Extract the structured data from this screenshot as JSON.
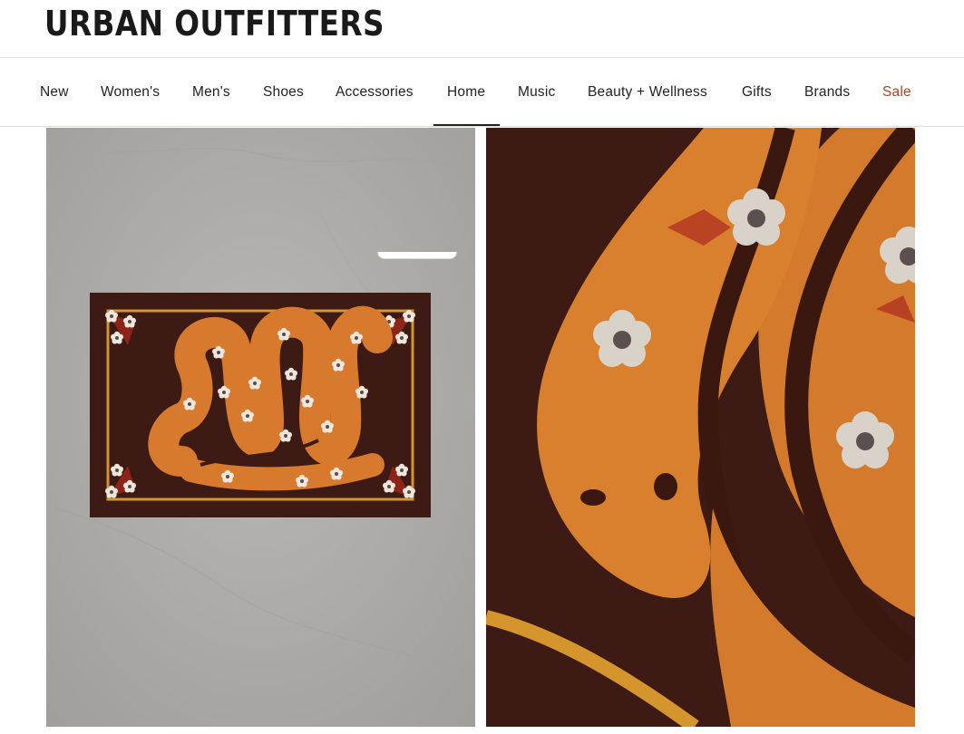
{
  "header": {
    "logo": "URBAN OUTFITTERS"
  },
  "nav": {
    "items": [
      {
        "label": "New"
      },
      {
        "label": "Women's"
      },
      {
        "label": "Men's"
      },
      {
        "label": "Shoes"
      },
      {
        "label": "Accessories"
      },
      {
        "label": "Home",
        "active": true
      },
      {
        "label": "Music"
      },
      {
        "label": "Beauty + Wellness"
      },
      {
        "label": "Gifts"
      },
      {
        "label": "Brands"
      },
      {
        "label": "Sale",
        "color": "#b1401f"
      }
    ]
  },
  "colors": {
    "doormat_brown": "#3d1a14",
    "snake_orange": "#d87a2e",
    "wall_gray": "#aeadaa",
    "sale_accent": "#b1401f"
  }
}
